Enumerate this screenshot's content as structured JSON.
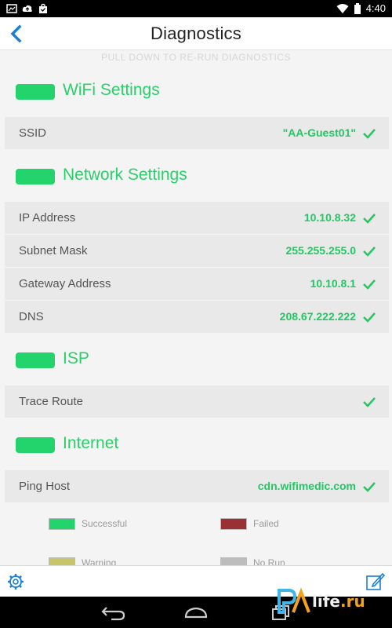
{
  "status_bar": {
    "time": "4:40"
  },
  "header": {
    "title": "Diagnostics"
  },
  "pull_hint": "PULL DOWN TO RE-RUN DIAGNOSTICS",
  "sections": [
    {
      "title": "WiFi Settings",
      "status_color": "#22d46b",
      "rows": [
        {
          "label": "SSID",
          "value": "\"AA-Guest01\""
        }
      ]
    },
    {
      "title": "Network Settings",
      "status_color": "#22d46b",
      "rows": [
        {
          "label": "IP Address",
          "value": "10.10.8.32"
        },
        {
          "label": "Subnet Mask",
          "value": "255.255.255.0"
        },
        {
          "label": "Gateway Address",
          "value": "10.10.8.1"
        },
        {
          "label": "DNS",
          "value": "208.67.222.222"
        }
      ]
    },
    {
      "title": "ISP",
      "status_color": "#22d46b",
      "rows": [
        {
          "label": "Trace Route",
          "value": ""
        }
      ]
    },
    {
      "title": "Internet",
      "status_color": "#22d46b",
      "rows": [
        {
          "label": "Ping Host",
          "value": "cdn.wifimedic.com"
        }
      ]
    }
  ],
  "legend": [
    {
      "label": "Successful",
      "color": "#22d46b"
    },
    {
      "label": "Failed",
      "color": "#9a2f34"
    },
    {
      "label": "Warning",
      "color": "#c8c46a"
    },
    {
      "label": "No Run",
      "color": "#bdbdbd"
    }
  ],
  "colors": {
    "accent": "#2bcf6a",
    "link": "#1a7fd6"
  },
  "icons": {
    "back": "chevron-left-icon",
    "check": "check-icon",
    "settings": "gear-icon",
    "compose": "compose-icon"
  },
  "watermark": {
    "pda": "PDA",
    "life": "life",
    "ru": ".ru"
  }
}
